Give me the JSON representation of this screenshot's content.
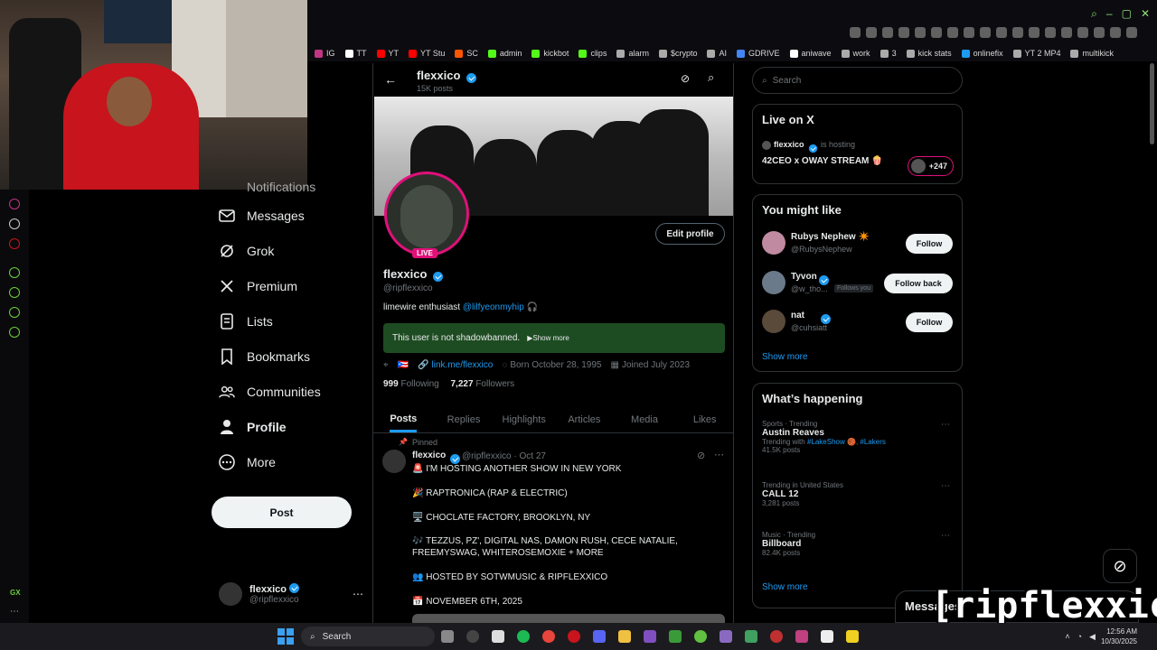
{
  "bookmarks": [
    {
      "label": "IG",
      "color": "#c13584"
    },
    {
      "label": "TT",
      "color": "#ffffff"
    },
    {
      "label": "YT",
      "color": "#ff0000"
    },
    {
      "label": "YT Stu",
      "color": "#ff0000"
    },
    {
      "label": "SC",
      "color": "#ff5500"
    },
    {
      "label": "admin",
      "color": "#53fc18"
    },
    {
      "label": "kickbot",
      "color": "#53fc18"
    },
    {
      "label": "clips",
      "color": "#53fc18"
    },
    {
      "label": "alarm",
      "color": "#aaaaaa"
    },
    {
      "label": "$crypto",
      "color": "#aaaaaa"
    },
    {
      "label": "AI",
      "color": "#aaaaaa"
    },
    {
      "label": "GDRIVE",
      "color": "#4285f4"
    },
    {
      "label": "aniwave",
      "color": "#ffffff"
    },
    {
      "label": "work",
      "color": "#aaaaaa"
    },
    {
      "label": "3",
      "color": "#aaaaaa"
    },
    {
      "label": "kick stats",
      "color": "#aaaaaa"
    },
    {
      "label": "onlinefix",
      "color": "#1d9bf0"
    },
    {
      "label": "YT 2 MP4",
      "color": "#aaaaaa"
    },
    {
      "label": "multikick",
      "color": "#aaaaaa"
    }
  ],
  "nav": {
    "notifications": "Notifications",
    "messages": "Messages",
    "grok": "Grok",
    "premium": "Premium",
    "lists": "Lists",
    "bookmarks": "Bookmarks",
    "communities": "Communities",
    "profile": "Profile",
    "more": "More",
    "post_button": "Post"
  },
  "account": {
    "name": "flexxico",
    "handle": "@ripflexxico"
  },
  "header": {
    "name": "flexxico",
    "posts": "15K posts"
  },
  "profile": {
    "live_badge": "LIVE",
    "edit_button": "Edit profile",
    "name": "flexxico",
    "handle": "@ripflexxico",
    "bio_text": "limewire enthusiast ",
    "bio_mention": "@lilfyeonmyhip",
    "bio_emoji": "🎧",
    "shadowban_text": "This user is not shadowbanned.",
    "show_more": "▶Show more",
    "location": "🇵🇷",
    "link": "link.me/flexxico",
    "born": "Born October 28, 1995",
    "joined": "Joined July 2023",
    "following_count": "999",
    "following_label": "Following",
    "followers_count": "7,227",
    "followers_label": "Followers"
  },
  "tabs": [
    "Posts",
    "Replies",
    "Highlights",
    "Articles",
    "Media",
    "Likes"
  ],
  "post": {
    "pinned": "Pinned",
    "name": "flexxico",
    "handle_date": "@ripflexxico · Oct 27",
    "lines": [
      "🚨 I'M HOSTING ANOTHER SHOW IN NEW YORK",
      "🎉 RAPTRONICA (RAP & ELECTRIC)",
      "🖥️ CHOCLATE FACTORY, BROOKLYN, NY",
      "🎶 TEZZUS, PZ', DIGITAL NAS, DAMON RUSH, CECE NATALIE,",
      "FREEMYSWAG, WHITEROSEMOXIE + MORE",
      "👥 HOSTED BY SOTWMUSIC & RIPFLEXXICO",
      "📅 NOVEMBER 6TH, 2025"
    ]
  },
  "search": {
    "placeholder": "Search"
  },
  "live_on_x": {
    "title": "Live on X",
    "host": "flexxico",
    "hosting": "is hosting",
    "stream_title": "42CEO x OWAY STREAM 🍿",
    "listeners": "+247"
  },
  "suggestions": {
    "title": "You might like",
    "users": [
      {
        "name": "Rubys Nephew ✴️",
        "handle": "@RubysNephew",
        "button": "Follow",
        "follows_you": ""
      },
      {
        "name": "Tyvon",
        "handle": "@w_tho...",
        "button": "Follow back",
        "follows_you": "Follows you"
      },
      {
        "name": "nat",
        "handle": "@cuhsiatt",
        "button": "Follow",
        "follows_you": ""
      }
    ],
    "show_more": "Show more"
  },
  "trends": {
    "title": "What’s happening",
    "items": [
      {
        "category": "Sports · Trending",
        "name": "Austin Reaves",
        "extra": "Trending with #LakeShow 🏀, #Lakers",
        "count": "41.5K posts"
      },
      {
        "category": "Trending in United States",
        "name": "CALL 12",
        "extra": "",
        "count": "3,281 posts"
      },
      {
        "category": "Music · Trending",
        "name": "Billboard",
        "extra": "",
        "count": "82.4K posts"
      }
    ],
    "show_more": "Show more"
  },
  "messages_drawer": "Messages",
  "overlay_name": "[ripflexxico]",
  "taskbar": {
    "search": "Search",
    "time": "12:56 AM",
    "date": "10/30/2025"
  },
  "colors": {
    "accent": "#1d9bf0",
    "live": "#e0107a",
    "shadowban_bg": "#1e4c22",
    "opera_green": "#6ad03c"
  }
}
